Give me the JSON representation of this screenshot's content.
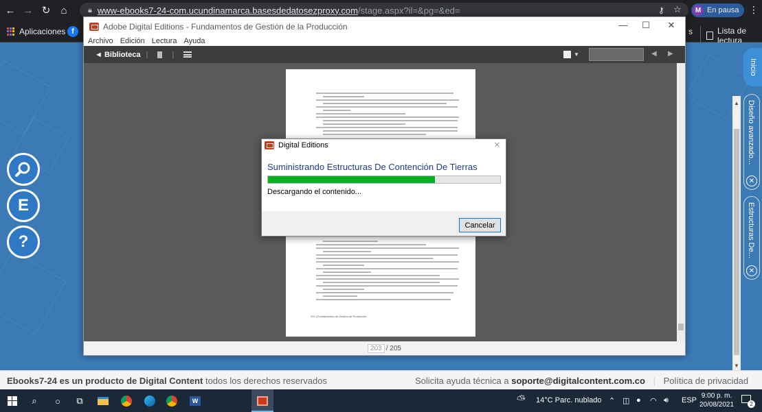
{
  "browser": {
    "url_host": "www-ebooks7-24-com.ucundinamarca.basesdedatosezproxy.com",
    "url_path": "/stage.aspx?il=&pg=&ed=",
    "profile_initial": "M",
    "profile_status": "En pausa",
    "bookmarks": {
      "apps_label": "Aplicaciones",
      "truncated": "s",
      "reading_list": "Lista de lectura"
    }
  },
  "site": {
    "side_buttons": [
      "E",
      "?"
    ],
    "right_tabs": {
      "active": "Inicio",
      "tab1": "Diseño avanzado...",
      "tab2": "Estructuras De..."
    },
    "footer": {
      "left_prefix": "Ebooks7-24 es un producto de",
      "left_brand": "Digital Content",
      "left_suffix": "todos los derechos reservados",
      "support_prefix": "Solicita ayuda técnica a",
      "support_email": "soporte@digitalcontent.com.co",
      "privacy": "Política de privacidad"
    }
  },
  "ade": {
    "title": "Adobe Digital Editions - Fundamentos de Gestión de la Producción",
    "menu": [
      "Archivo",
      "Edición",
      "Lectura",
      "Ayuda"
    ],
    "library_label": "◄ Biblioteca",
    "page_current": "203",
    "page_total": "/ 205",
    "book_footer": "202 | Fundamentos de Gestión de Producción"
  },
  "dialog": {
    "title": "Digital Editions",
    "heading": "Suministrando Estructuras De Contención De Tierras",
    "progress": 0.72,
    "status": "Descargando el contenido...",
    "cancel_label": "Cancelar"
  },
  "taskbar": {
    "weather": "14°C  Parc. nublado",
    "lang": "ESP",
    "time": "9:00 p. m.",
    "date": "20/08/2021",
    "notif_count": "2"
  },
  "colors": {
    "progress_fill": "#06b025",
    "dialog_heading": "#1f3c8c",
    "site_blue": "#3c7ab5"
  }
}
